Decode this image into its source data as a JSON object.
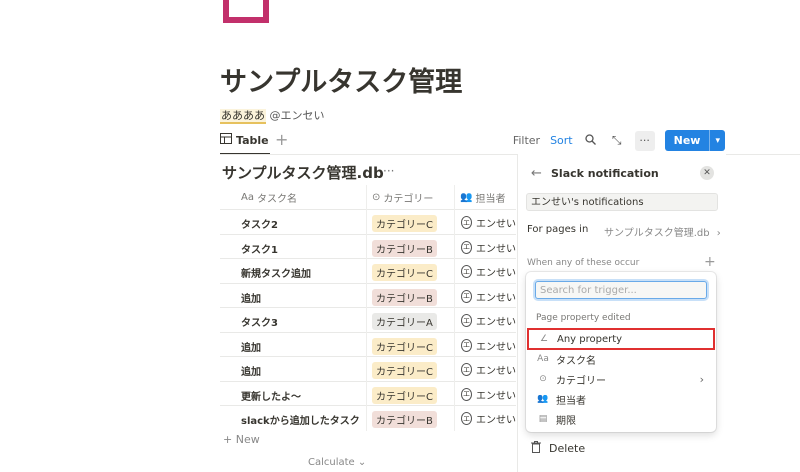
{
  "page": {
    "title": "サンプルタスク管理",
    "author_highlight": "ああああ",
    "author_mention": "@エンセい"
  },
  "toolbar": {
    "tab_label": "Table",
    "add_icon": "plus-icon",
    "filter_label": "Filter",
    "sort_label": "Sort",
    "new_label": "New",
    "accent_color": "#2383e2"
  },
  "database": {
    "title": "サンプルタスク管理.db",
    "more": "···",
    "columns": {
      "name": "タスク名",
      "name_icon": "Aa",
      "category": "カテゴリー",
      "assignee": "担当者"
    },
    "rows": [
      {
        "name": "タスク2",
        "category": "カテゴリーC",
        "assignee": "エンせい"
      },
      {
        "name": "タスク1",
        "category": "カテゴリーB",
        "assignee": "エンせい"
      },
      {
        "name": "新規タスク追加",
        "category": "カテゴリーC",
        "assignee": "エンせい"
      },
      {
        "name": "追加",
        "category": "カテゴリーB",
        "assignee": "エンせい"
      },
      {
        "name": "タスク3",
        "category": "カテゴリーA",
        "assignee": "エンせい"
      },
      {
        "name": "追加",
        "category": "カテゴリーC",
        "assignee": "エンせい"
      },
      {
        "name": "追加",
        "category": "カテゴリーC",
        "assignee": "エンせい"
      },
      {
        "name": "更新したよ〜",
        "category": "カテゴリーC",
        "assignee": "エンせい"
      },
      {
        "name": "slackから追加したタスク",
        "category": "カテゴリーB",
        "assignee": "エンせい"
      }
    ],
    "new_row_label": "+ New",
    "calculate_label": "Calculate ⌄",
    "category_colors": {
      "カテゴリーA": "#e9e9e7",
      "カテゴリーB": "#f1ded9",
      "カテゴリーC": "#fbecc8"
    }
  },
  "panel": {
    "title": "Slack notification",
    "notification_name": "エンせい's notifications",
    "pages_in_label": "For pages in",
    "pages_in_value": "サンプルタスク管理.db",
    "occur_label": "When any of these occur",
    "delete_label": "Delete"
  },
  "dropdown": {
    "search_placeholder": "Search for trigger...",
    "section_label": "Page property edited",
    "items": [
      {
        "label": "Any property",
        "icon": "pencil-icon",
        "selected": true
      },
      {
        "label": "タスク名",
        "icon": "text-property-icon"
      },
      {
        "label": "カテゴリー",
        "icon": "select-property-icon",
        "has_submenu": true
      },
      {
        "label": "担当者",
        "icon": "people-icon"
      },
      {
        "label": "期限",
        "icon": "calendar-icon"
      }
    ]
  }
}
